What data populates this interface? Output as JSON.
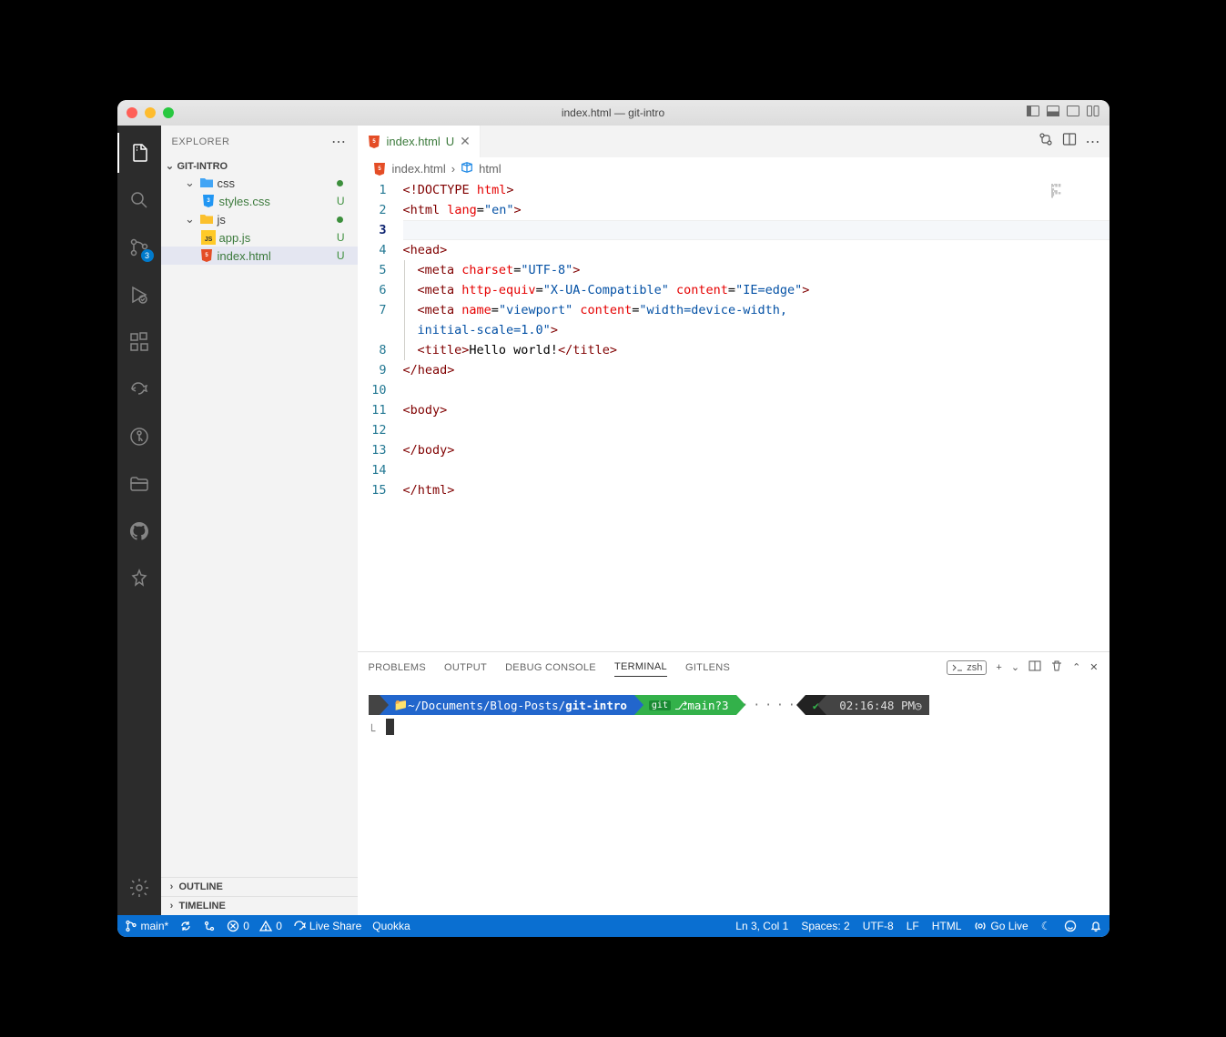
{
  "window": {
    "title": "index.html — git-intro"
  },
  "sidebar": {
    "header": "EXPLORER",
    "project": "GIT-INTRO",
    "scm_badge": "3",
    "items": {
      "css_folder": "css",
      "styles": "styles.css",
      "styles_status": "U",
      "js_folder": "js",
      "appjs": "app.js",
      "appjs_status": "U",
      "index": "index.html",
      "index_status": "U"
    },
    "outline": "OUTLINE",
    "timeline": "TIMELINE"
  },
  "tab": {
    "name": "index.html",
    "status": "U"
  },
  "breadcrumb": {
    "file": "index.html",
    "symbol": "html"
  },
  "editor": {
    "line_numbers": [
      "1",
      "2",
      "3",
      "4",
      "5",
      "6",
      "7",
      "8",
      "9",
      "10",
      "11",
      "12",
      "13",
      "14",
      "15"
    ]
  },
  "code": {
    "doctype_open": "<!",
    "doctype_kw": "DOCTYPE",
    "doctype_html": "html",
    "gt": ">",
    "html_open": "<html",
    "lang_attr": "lang",
    "eq": "=",
    "lang_val": "\"en\"",
    "head_open": "<head>",
    "head_close": "</head>",
    "meta1_tag": "<meta",
    "meta1_attr": "charset",
    "meta1_val": "\"UTF-8\"",
    "meta2_tag": "<meta",
    "meta2_attr": "http-equiv",
    "meta2_val": "\"X-UA-Compatible\"",
    "meta2_attr2": "content",
    "meta2_val2": "\"IE=edge\"",
    "meta3_tag": "<meta",
    "meta3_attr": "name",
    "meta3_val": "\"viewport\"",
    "meta3_attr2": "content",
    "meta3_val2a": "\"width=device-width, ",
    "meta3_val2b": "initial-scale=1.0\"",
    "title_open": "<title>",
    "title_text": "Hello world!",
    "title_close": "</title>",
    "body_open": "<body>",
    "body_close": "</body>",
    "html_close": "</html>"
  },
  "panel": {
    "tabs": {
      "problems": "PROBLEMS",
      "output": "OUTPUT",
      "debug": "DEBUG CONSOLE",
      "terminal": "TERMINAL",
      "gitlens": "GITLENS"
    },
    "shell": "zsh"
  },
  "terminal": {
    "path": "~/Documents/Blog-Posts/",
    "path_bold": "git-intro",
    "branch": "main",
    "branch_status": "?3",
    "git_label": "git",
    "check": "✔",
    "time": "02:16:48 PM",
    "clock_icon": "◷"
  },
  "status": {
    "branch": "main*",
    "errors": "0",
    "warnings": "0",
    "liveshare": "Live Share",
    "quokka": "Quokka",
    "cursor": "Ln 3, Col 1",
    "spaces": "Spaces: 2",
    "encoding": "UTF-8",
    "eol": "LF",
    "lang": "HTML",
    "golive": "Go Live"
  }
}
